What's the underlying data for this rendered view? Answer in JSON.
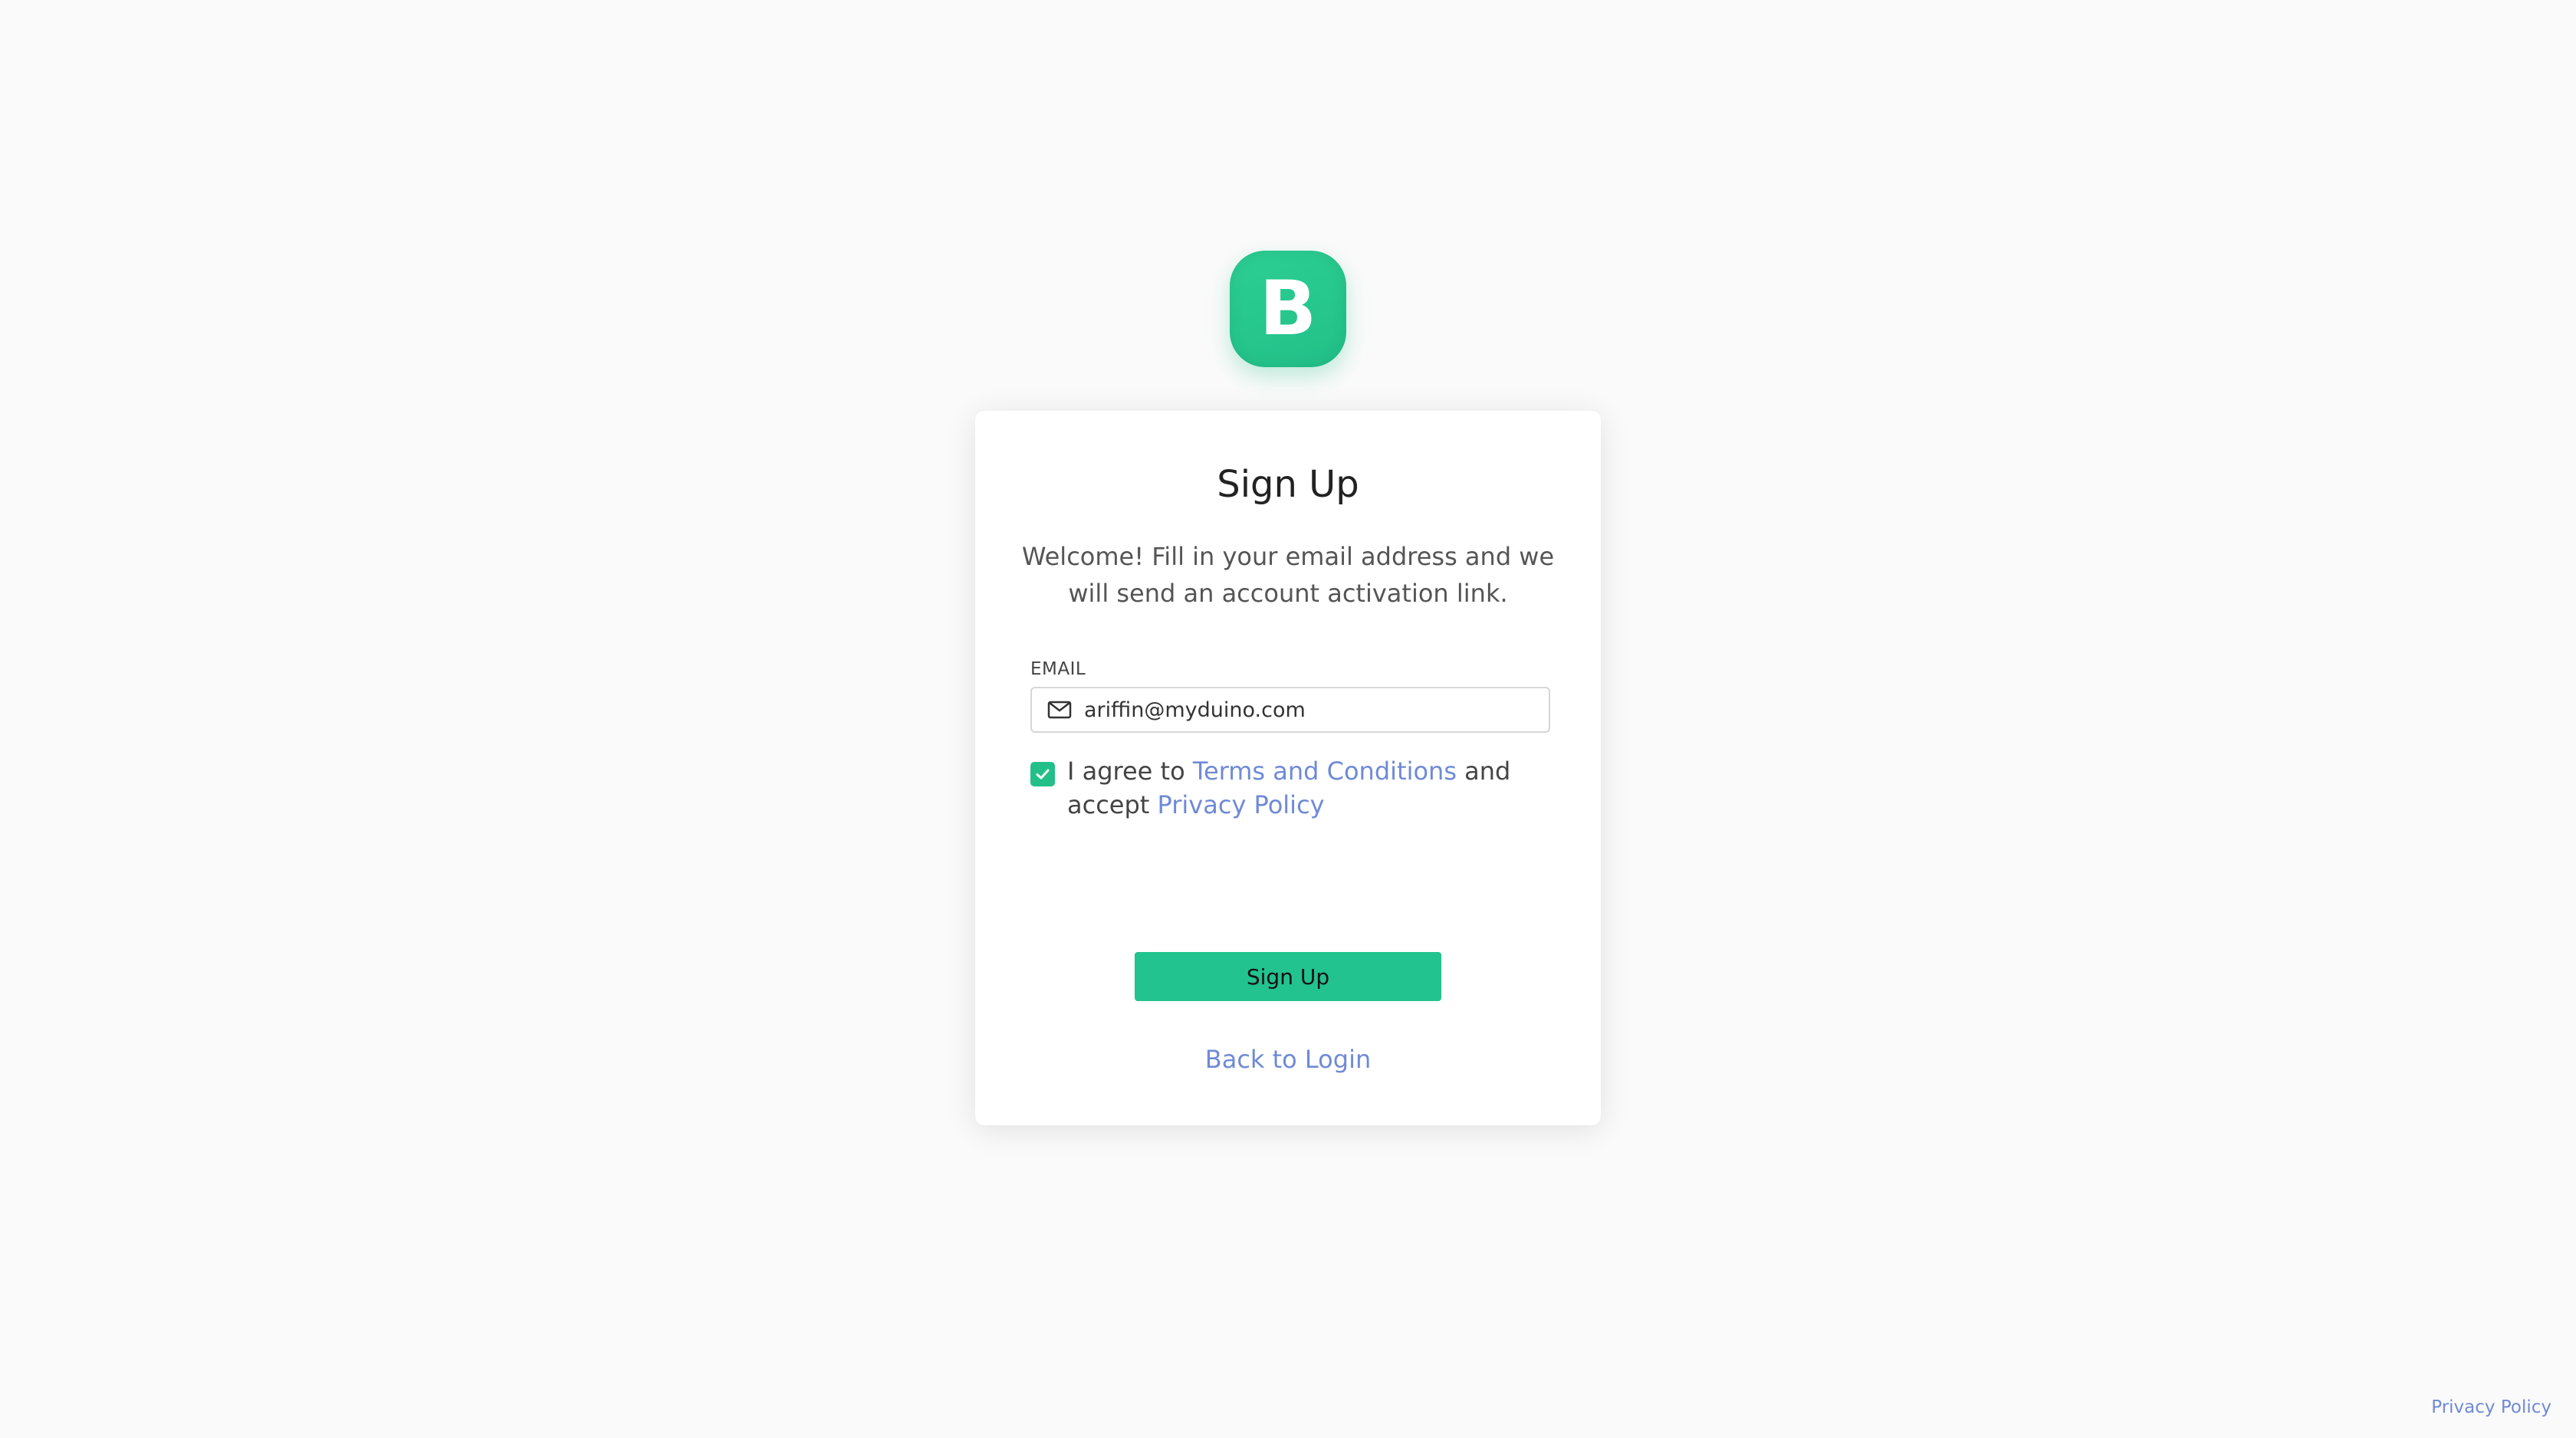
{
  "logo": {
    "letter": "B"
  },
  "signup": {
    "title": "Sign Up",
    "subtitle": "Welcome! Fill in your email address and we will send an account activation link.",
    "email_label": "EMAIL",
    "email_value": "ariffin@myduino.com",
    "agreement": {
      "checked": true,
      "prefix": "I agree to ",
      "terms_link": "Terms and Conditions",
      "middle": " and accept ",
      "privacy_link": "Privacy Policy"
    },
    "submit_label": "Sign Up",
    "back_link": "Back to Login"
  },
  "footer": {
    "privacy_link": "Privacy Policy"
  },
  "colors": {
    "page_background": "#fafafa",
    "brand_green": "#22c088",
    "link_blue": "#6f8ad6",
    "card_background": "#ffffff"
  },
  "icons": {
    "email": "mail-icon",
    "checkbox": "check-icon"
  }
}
